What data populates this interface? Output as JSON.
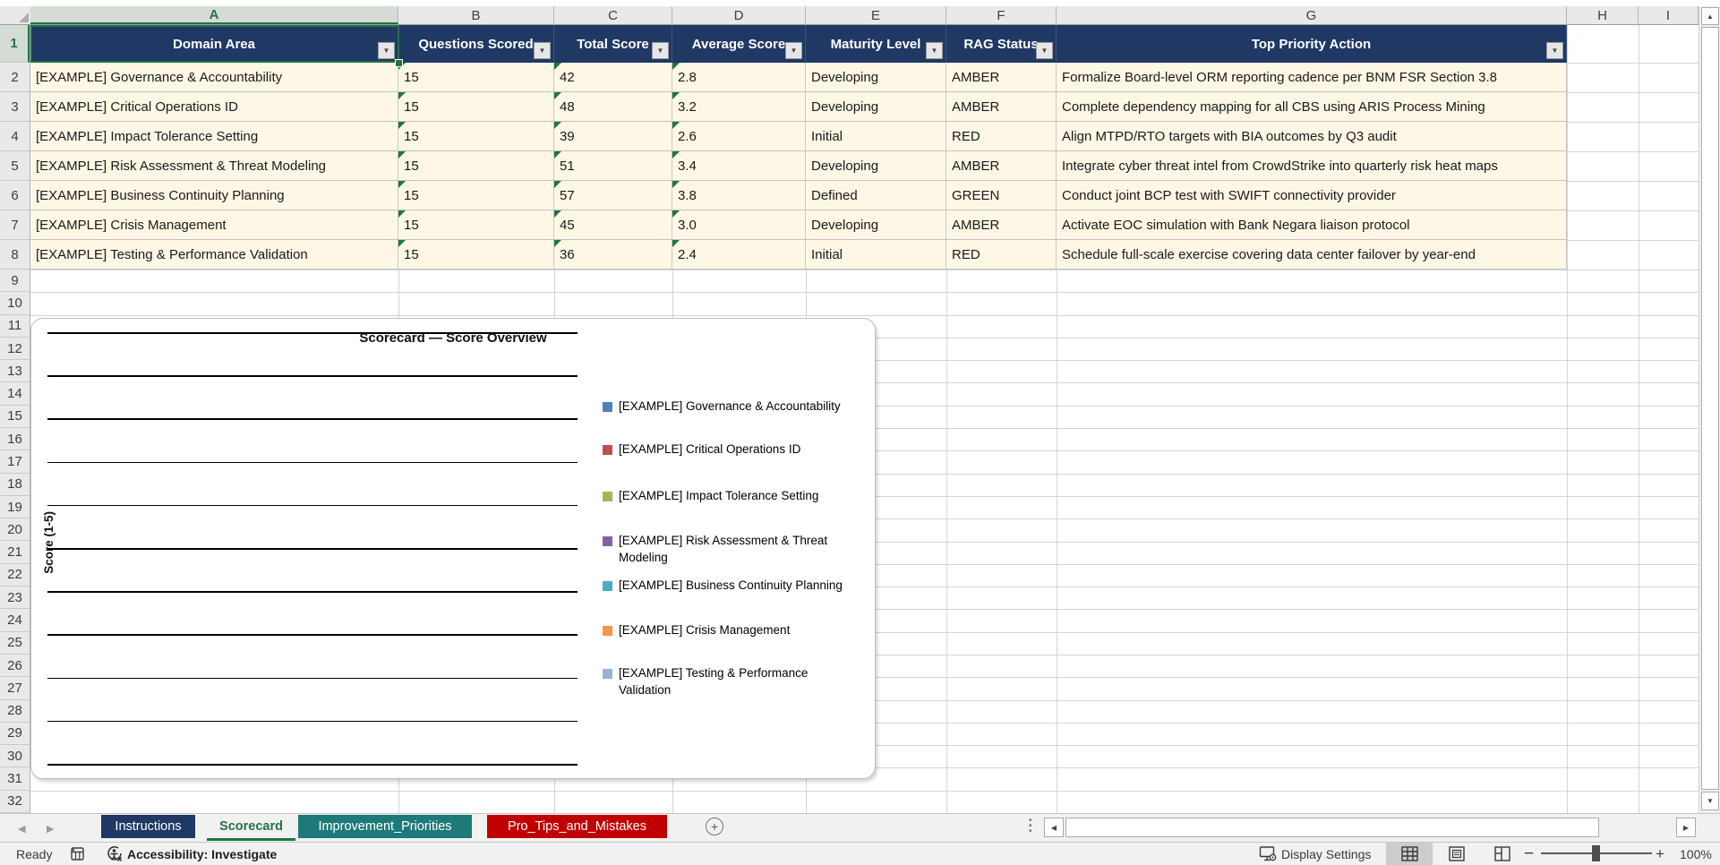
{
  "columns": {
    "letters": [
      "A",
      "B",
      "C",
      "D",
      "E",
      "F",
      "G",
      "H",
      "I"
    ],
    "selected": "A"
  },
  "rows": {
    "numbers": [
      "1",
      "2",
      "3",
      "4",
      "5",
      "6",
      "7",
      "8",
      "9",
      "10",
      "11",
      "12",
      "13",
      "14",
      "15",
      "16",
      "17",
      "18",
      "19",
      "20",
      "21",
      "22",
      "23",
      "24",
      "25",
      "26",
      "27",
      "28",
      "29",
      "30",
      "31",
      "32"
    ],
    "selected": "1"
  },
  "table": {
    "headers": [
      "Domain Area",
      "Questions Scored",
      "Total Score",
      "Average Score",
      "Maturity Level",
      "RAG Status",
      "Top Priority Action"
    ],
    "header_bg": "#1F3864",
    "row_bg": "#FEF7E6",
    "rows": [
      {
        "domain": "[EXAMPLE] Governance & Accountability",
        "questions": "15",
        "total": "42",
        "avg": "2.8",
        "maturity": "Developing",
        "rag": "AMBER",
        "action": "Formalize Board-level ORM reporting cadence per BNM FSR Section 3.8"
      },
      {
        "domain": "[EXAMPLE] Critical Operations ID",
        "questions": "15",
        "total": "48",
        "avg": "3.2",
        "maturity": "Developing",
        "rag": "AMBER",
        "action": "Complete dependency mapping for all CBS using ARIS Process Mining"
      },
      {
        "domain": "[EXAMPLE] Impact Tolerance Setting",
        "questions": "15",
        "total": "39",
        "avg": "2.6",
        "maturity": "Initial",
        "rag": "RED",
        "action": "Align MTPD/RTO targets with BIA outcomes by Q3 audit"
      },
      {
        "domain": "[EXAMPLE] Risk Assessment & Threat Modeling",
        "questions": "15",
        "total": "51",
        "avg": "3.4",
        "maturity": "Developing",
        "rag": "AMBER",
        "action": "Integrate cyber threat intel from CrowdStrike into quarterly risk heat maps"
      },
      {
        "domain": "[EXAMPLE] Business Continuity Planning",
        "questions": "15",
        "total": "57",
        "avg": "3.8",
        "maturity": "Defined",
        "rag": "GREEN",
        "action": "Conduct joint BCP test with SWIFT connectivity provider"
      },
      {
        "domain": "[EXAMPLE] Crisis Management",
        "questions": "15",
        "total": "45",
        "avg": "3.0",
        "maturity": "Developing",
        "rag": "AMBER",
        "action": "Activate EOC simulation with Bank Negara liaison protocol"
      },
      {
        "domain": "[EXAMPLE] Testing & Performance Validation",
        "questions": "15",
        "total": "36",
        "avg": "2.4",
        "maturity": "Initial",
        "rag": "RED",
        "action": "Schedule full-scale exercise covering data center failover by year-end"
      }
    ]
  },
  "chart": {
    "title": "Scorecard — Score Overview",
    "y_axis_label": "Score (1-5)",
    "legend": [
      {
        "label": "[EXAMPLE] Governance & Accountability",
        "color": "#4F81BD"
      },
      {
        "label": "[EXAMPLE] Critical Operations ID",
        "color": "#C0504D"
      },
      {
        "label": "[EXAMPLE] Impact Tolerance Setting",
        "color": "#9BBB59"
      },
      {
        "label": "[EXAMPLE] Risk Assessment & Threat Modeling",
        "color": "#8064A2"
      },
      {
        "label": "[EXAMPLE] Business Continuity Planning",
        "color": "#4BACC6"
      },
      {
        "label": "[EXAMPLE] Crisis Management",
        "color": "#F79646"
      },
      {
        "label": "[EXAMPLE] Testing & Performance Validation",
        "color": "#95B3D7"
      }
    ]
  },
  "chart_data": {
    "type": "bar",
    "title": "Scorecard — Score Overview",
    "ylabel": "Score (1-5)",
    "categories": [
      "[EXAMPLE] Governance & Accountability",
      "[EXAMPLE] Critical Operations ID",
      "[EXAMPLE] Impact Tolerance Setting",
      "[EXAMPLE] Risk Assessment & Threat Modeling",
      "[EXAMPLE] Business Continuity Planning",
      "[EXAMPLE] Crisis Management",
      "[EXAMPLE] Testing & Performance Validation"
    ],
    "values_plotted": false,
    "gridline_count": 11,
    "legend_position": "right"
  },
  "sheet_tabs": [
    {
      "label": "Instructions",
      "bg": "#1F3864",
      "fg": "#FFFFFF",
      "active": false
    },
    {
      "label": "Scorecard",
      "bg": "#F1F1F1",
      "fg": "#217346",
      "active": true
    },
    {
      "label": "Improvement_Priorities",
      "bg": "#1E7A78",
      "fg": "#FFFFFF",
      "active": false
    },
    {
      "label": "Pro_Tips_and_Mistakes",
      "bg": "#C00000",
      "fg": "#FFFFFF",
      "active": false
    }
  ],
  "status_bar": {
    "ready_label": "Ready",
    "accessibility_label": "Accessibility: Investigate",
    "display_settings_label": "Display Settings",
    "zoom_level": "100%"
  },
  "theme": {
    "excel_green": "#217346",
    "header_navy": "#1F3864",
    "cell_cream": "#FEF7E6"
  }
}
